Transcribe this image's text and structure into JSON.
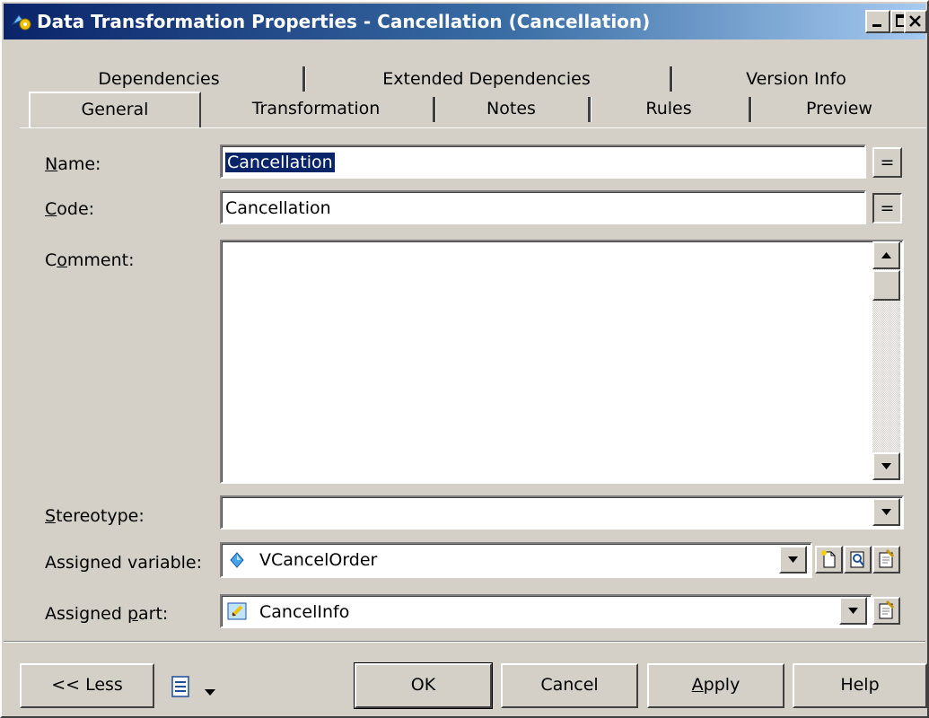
{
  "window": {
    "title": "Data Transformation Properties - Cancellation (Cancellation)",
    "minimize_icon": "minimize-icon",
    "close_icon": "close-icon",
    "accent": "#0a246a"
  },
  "tabs": {
    "row1": [
      "Dependencies",
      "Extended Dependencies",
      "Version Info"
    ],
    "row2": [
      "General",
      "Transformation",
      "Notes",
      "Rules",
      "Preview"
    ],
    "active": "General"
  },
  "form": {
    "name_label": {
      "pre": "",
      "key": "N",
      "post": "ame:"
    },
    "name_value": "Cancellation",
    "code_label": {
      "pre": "",
      "key": "C",
      "post": "ode:"
    },
    "code_value": "Cancellation",
    "equals_label": "=",
    "comment_label": {
      "pre": "C",
      "key": "o",
      "post": "mment:"
    },
    "comment_value": "",
    "stereotype_label": {
      "pre": "",
      "key": "S",
      "post": "tereotype:"
    },
    "stereotype_value": "",
    "assigned_variable_label": "Assigned variable:",
    "assigned_variable_value": "VCancelOrder",
    "assigned_part_label": {
      "pre": "Assigned ",
      "key": "p",
      "post": "art:"
    },
    "assigned_part_value": "CancelInfo"
  },
  "footer": {
    "less_label": "<< Less",
    "ok_label": "OK",
    "cancel_label": "Cancel",
    "apply_label": {
      "pre": "",
      "key": "A",
      "post": "pply"
    },
    "help_label": "Help"
  }
}
